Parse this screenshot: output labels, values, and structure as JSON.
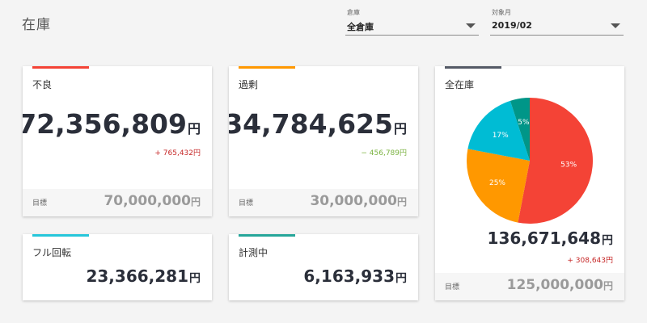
{
  "header": {
    "title": "在庫"
  },
  "filters": {
    "warehouse": {
      "label": "倉庫",
      "value": "全倉庫"
    },
    "month": {
      "label": "対象月",
      "value": "2019/02"
    }
  },
  "yen": "円",
  "cards": {
    "defect": {
      "title": "不良",
      "accent": "#f44336",
      "value": "72,356,809",
      "delta": "+ 765,432円",
      "delta_color": "#c62828",
      "target_label": "目標",
      "target_value": "70,000,000"
    },
    "excess": {
      "title": "過剰",
      "accent": "#ff9800",
      "value": "34,784,625",
      "delta": "− 456,789円",
      "delta_color": "#7cb342",
      "target_label": "目標",
      "target_value": "30,000,000"
    },
    "full": {
      "title": "フル回転",
      "accent": "#26c6da",
      "value": "23,366,281"
    },
    "measuring": {
      "title": "計測中",
      "accent": "#26a69a",
      "value": "6,163,933"
    },
    "total": {
      "title": "全在庫",
      "accent": "#555a66",
      "value": "136,671,648",
      "delta": "+ 308,643円",
      "delta_color": "#c62828",
      "target_label": "目標",
      "target_value": "125,000,000"
    }
  },
  "chart_data": {
    "type": "pie",
    "slices": [
      {
        "label": "53%",
        "value": 53,
        "color": "#f44336"
      },
      {
        "label": "25%",
        "value": 25,
        "color": "#ff9800"
      },
      {
        "label": "17%",
        "value": 17,
        "color": "#00bcd4"
      },
      {
        "label": "5%",
        "value": 5,
        "color": "#009688"
      }
    ]
  }
}
